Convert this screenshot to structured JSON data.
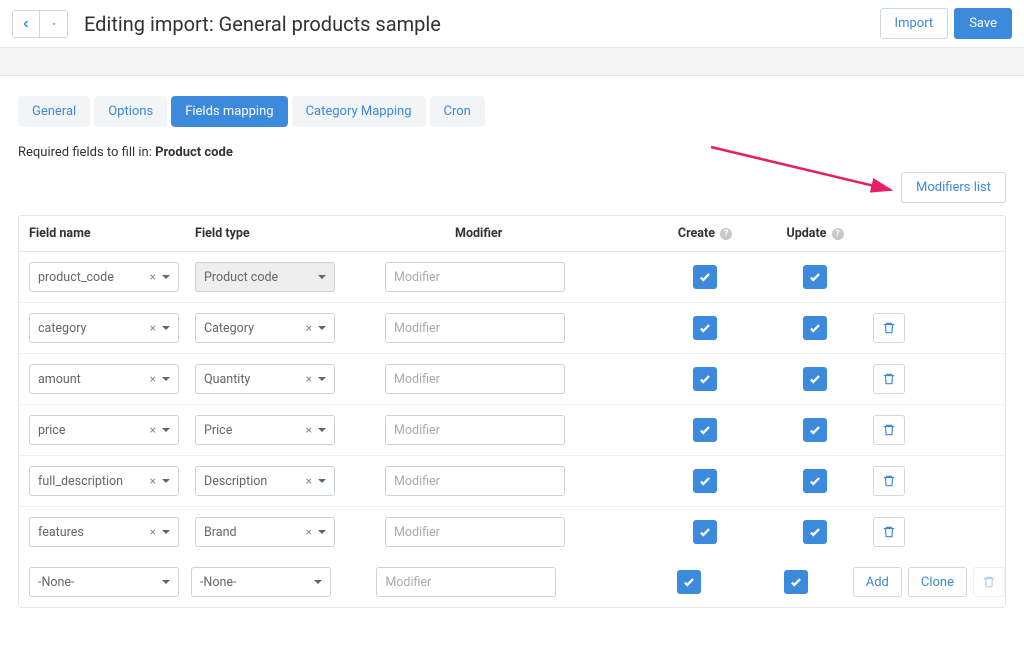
{
  "header": {
    "title": "Editing import: General products sample",
    "import_btn": "Import",
    "save_btn": "Save"
  },
  "tabs": [
    {
      "label": "General",
      "active": false
    },
    {
      "label": "Options",
      "active": false
    },
    {
      "label": "Fields mapping",
      "active": true
    },
    {
      "label": "Category Mapping",
      "active": false
    },
    {
      "label": "Cron",
      "active": false
    }
  ],
  "required_note_prefix": "Required fields to fill in: ",
  "required_note_field": "Product code",
  "modifiers_list_btn": "Modifiers list",
  "columns": {
    "name": "Field name",
    "type": "Field type",
    "modifier": "Modifier",
    "create": "Create",
    "update": "Update"
  },
  "modifier_placeholder": "Modifier",
  "none_label": "-None-",
  "add_btn": "Add",
  "clone_btn": "Clone",
  "rows": [
    {
      "name": "product_code",
      "type": "Product code",
      "locked": true,
      "create": true,
      "update": true,
      "delete": false
    },
    {
      "name": "category",
      "type": "Category",
      "locked": false,
      "create": true,
      "update": true,
      "delete": true
    },
    {
      "name": "amount",
      "type": "Quantity",
      "locked": false,
      "create": true,
      "update": true,
      "delete": true
    },
    {
      "name": "price",
      "type": "Price",
      "locked": false,
      "create": true,
      "update": true,
      "delete": true
    },
    {
      "name": "full_description",
      "type": "Description",
      "locked": false,
      "create": true,
      "update": true,
      "delete": true
    },
    {
      "name": "features",
      "type": "Brand",
      "locked": false,
      "create": true,
      "update": true,
      "delete": true
    }
  ]
}
